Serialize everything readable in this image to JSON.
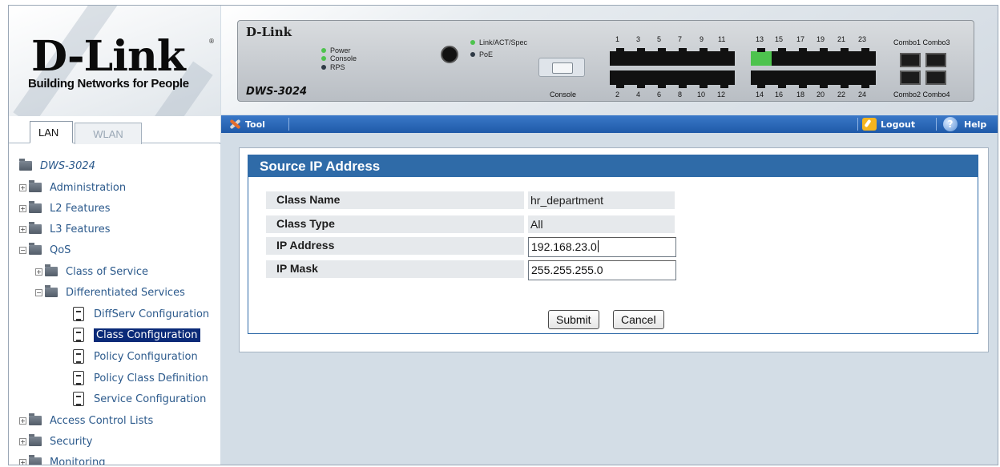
{
  "logo": {
    "brand": "D-Link",
    "tagline": "Building Networks for People"
  },
  "tabs": {
    "lan": "LAN",
    "wlan": "WLAN"
  },
  "tree": {
    "root": "DWS-3024",
    "administration": "Administration",
    "l2": "L2 Features",
    "l3": "L3 Features",
    "qos": "QoS",
    "class_of_service": "Class of Service",
    "diffserv": "Differentiated Services",
    "diffserv_config": "DiffServ Configuration",
    "class_config": "Class Configuration",
    "policy_config": "Policy Configuration",
    "policy_class_def": "Policy Class Definition",
    "service_config": "Service Configuration",
    "acl": "Access Control Lists",
    "security": "Security",
    "monitoring": "Monitoring"
  },
  "device": {
    "logo": "D-Link",
    "model": "DWS-3024",
    "leds": {
      "power": "Power",
      "console": "Console",
      "rps": "RPS",
      "link": "Link/ACT/Spec",
      "poe": "PoE"
    },
    "console_label": "Console",
    "top_ports": [
      "1",
      "3",
      "5",
      "7",
      "9",
      "11",
      "13",
      "15",
      "17",
      "19",
      "21",
      "23"
    ],
    "bottom_ports": [
      "2",
      "4",
      "6",
      "8",
      "10",
      "12",
      "14",
      "16",
      "18",
      "20",
      "22",
      "24"
    ],
    "combo_top": "Combo1 Combo3",
    "combo_bottom": "Combo2 Combo4",
    "colors": {
      "link_led": "#4ec34e",
      "rps_led": "#2f3a46"
    }
  },
  "toolbar": {
    "tool": "Tool",
    "logout": "Logout",
    "help": "Help"
  },
  "form": {
    "title": "Source IP Address",
    "class_name_label": "Class Name",
    "class_name_value": "hr_department",
    "class_type_label": "Class Type",
    "class_type_value": "All",
    "ip_address_label": "IP Address",
    "ip_address_value": "192.168.23.0",
    "ip_mask_label": "IP Mask",
    "ip_mask_value": "255.255.255.0",
    "submit": "Submit",
    "cancel": "Cancel"
  },
  "colors": {
    "header_blue": "#2f6ba8",
    "selected_bg": "#0a2a78",
    "content_bg": "#d3dde6"
  }
}
